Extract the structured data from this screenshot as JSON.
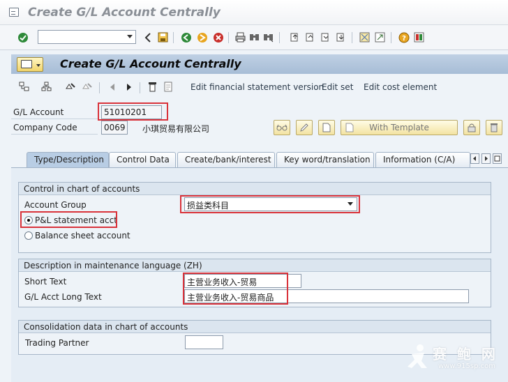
{
  "window": {
    "title": "Create G/L Account Centrally"
  },
  "system_toolbar": {
    "command_field": {
      "value": ""
    },
    "icons": [
      "enter-icon",
      "back-arrow-icon",
      "save-icon",
      "back-icon",
      "exit-icon",
      "cancel-icon",
      "print-icon",
      "find-icon",
      "find-next-icon",
      "first-page-icon",
      "previous-page-icon",
      "next-page-icon",
      "last-page-icon",
      "create-session-icon",
      "shortcut-icon",
      "help-icon",
      "layout-menu-icon"
    ]
  },
  "screen": {
    "title": "Create G/L Account Centrally"
  },
  "app_toolbar": {
    "links": [
      "Edit financial statement version",
      "Edit set",
      "Edit cost element"
    ]
  },
  "header": {
    "gl_account": {
      "label": "G/L Account",
      "value": "51010201"
    },
    "company_code": {
      "label": "Company Code",
      "value": "0069",
      "name": "小琪贸易有限公司"
    },
    "with_template_label": "With Template"
  },
  "tabs": [
    "Type/Description",
    "Control Data",
    "Create/bank/interest",
    "Key word/translation",
    "Information (C/A)"
  ],
  "control_group": {
    "title": "Control in chart of accounts",
    "account_group_label": "Account Group",
    "account_group_value": "损益类科目",
    "radio_pl": "P&L statement acct",
    "radio_bs": "Balance sheet account",
    "selected": "pl"
  },
  "description_group": {
    "title": "Description in maintenance language (ZH)",
    "short_text_label": "Short Text",
    "short_text_value": "主营业务收入-贸易",
    "long_text_label": "G/L Acct Long Text",
    "long_text_value": "主营业务收入-贸易商品"
  },
  "consolidation_group": {
    "title": "Consolidation data in chart of accounts",
    "trading_partner_label": "Trading Partner",
    "trading_partner_value": ""
  },
  "watermark": {
    "text": "赛 鲍 网",
    "url": "www.915sp.com"
  },
  "colors": {
    "accent": "#b8cde4",
    "highlight": "#d9323a",
    "button": "#f3e3a2"
  }
}
